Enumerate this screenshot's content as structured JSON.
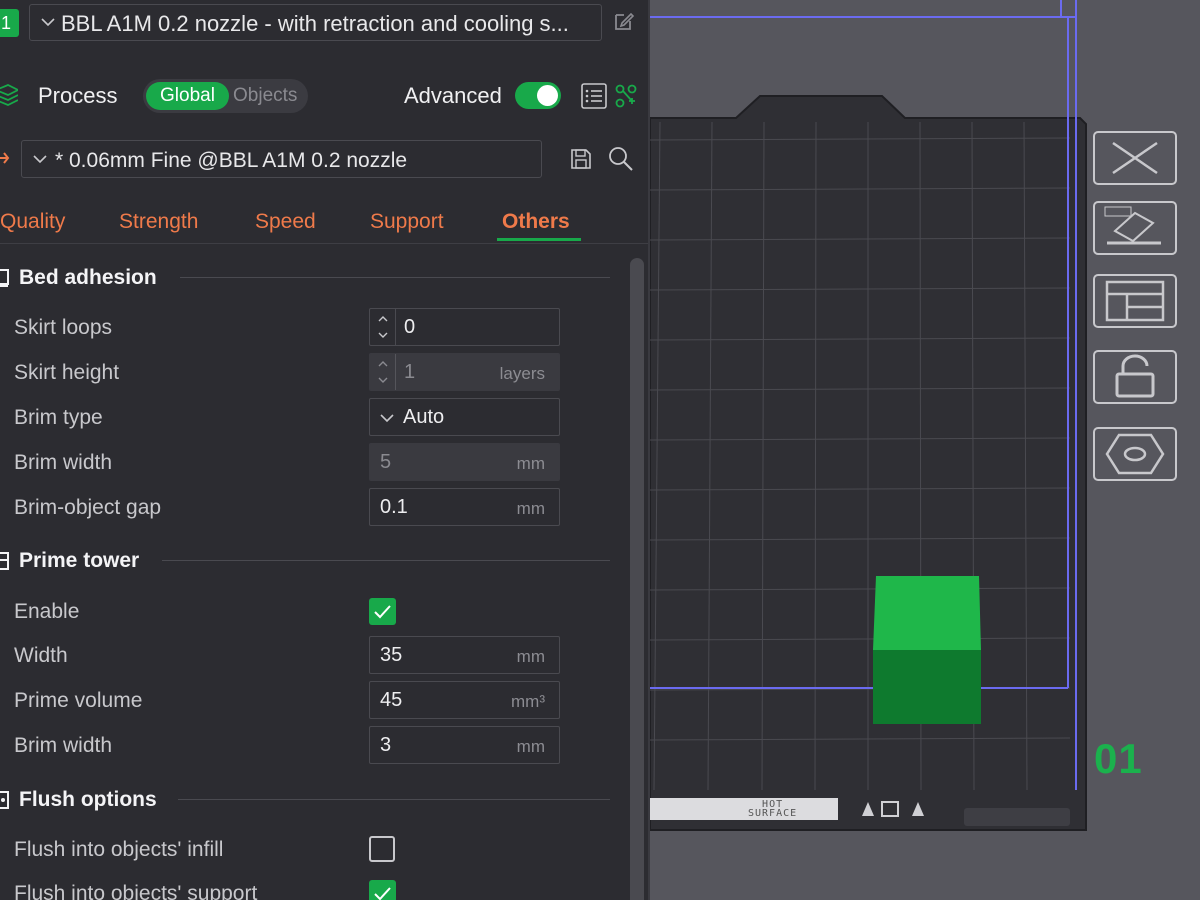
{
  "printer": {
    "index": "1",
    "name": "BBL A1M 0.2 nozzle - with retraction and cooling s..."
  },
  "process": {
    "label": "Process",
    "scope_global": "Global",
    "scope_objects": "Objects",
    "advanced_label": "Advanced",
    "advanced_on": true
  },
  "preset": {
    "name": "* 0.06mm Fine @BBL A1M 0.2 nozzle"
  },
  "tabs": [
    {
      "label": "Quality"
    },
    {
      "label": "Strength"
    },
    {
      "label": "Speed"
    },
    {
      "label": "Support"
    },
    {
      "label": "Others",
      "active": true
    }
  ],
  "sections": {
    "bed_adhesion": {
      "title": "Bed adhesion",
      "skirt_loops": {
        "label": "Skirt loops",
        "value": "0"
      },
      "skirt_height": {
        "label": "Skirt height",
        "value": "1",
        "unit": "layers"
      },
      "brim_type": {
        "label": "Brim type",
        "value": "Auto"
      },
      "brim_width": {
        "label": "Brim width",
        "value": "5",
        "unit": "mm"
      },
      "brim_object_gap": {
        "label": "Brim-object gap",
        "value": "0.1",
        "unit": "mm"
      }
    },
    "prime_tower": {
      "title": "Prime tower",
      "enable": {
        "label": "Enable",
        "checked": true
      },
      "width": {
        "label": "Width",
        "value": "35",
        "unit": "mm"
      },
      "prime_volume": {
        "label": "Prime volume",
        "value": "45",
        "unit": "mm³"
      },
      "brim_width": {
        "label": "Brim width",
        "value": "3",
        "unit": "mm"
      }
    },
    "flush_options": {
      "title": "Flush options",
      "into_infill": {
        "label": "Flush into objects' infill",
        "checked": false
      },
      "into_support": {
        "label": "Flush into objects' support",
        "checked": true
      }
    }
  },
  "plate": {
    "number": "01",
    "surface_label_line1": "HOT",
    "surface_label_line2": "SURFACE",
    "colors": {
      "plate": "#2f2f34",
      "grid": "#4a4a50",
      "boundary": "#6b6bf0",
      "object_top": "#1fb74a",
      "object_side": "#0e7a2e"
    }
  },
  "toolbar": {
    "buttons": [
      "close-icon",
      "auto-orient-icon",
      "arrange-icon",
      "lock-icon",
      "hexagon-icon"
    ]
  }
}
